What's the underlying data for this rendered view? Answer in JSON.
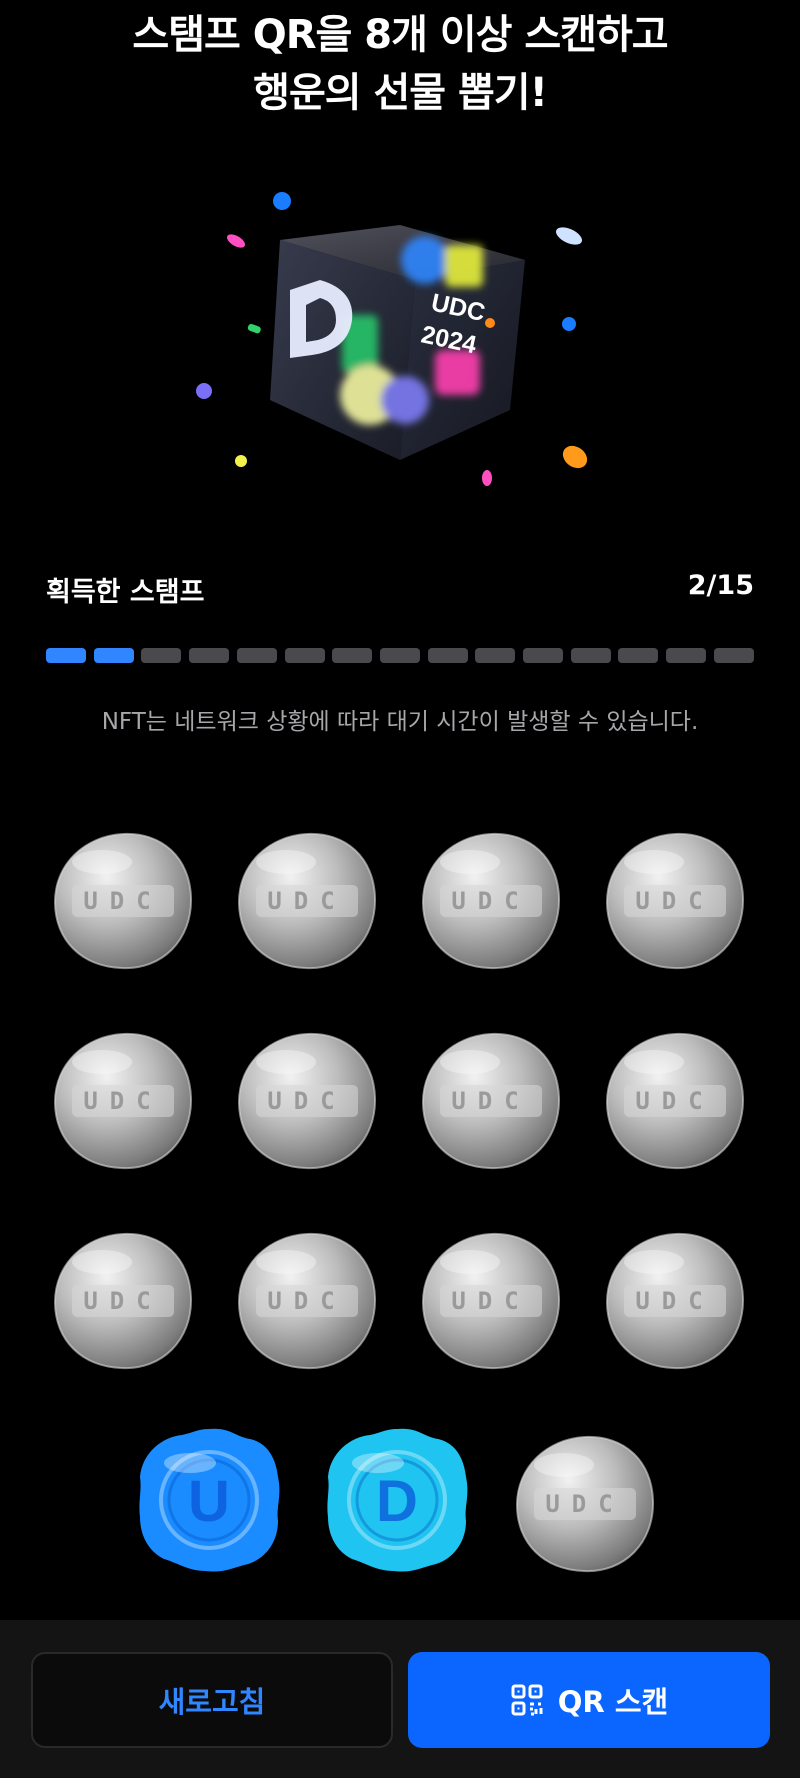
{
  "header": {
    "line1": "스탬프 QR을 8개 이상 스캔하고",
    "line2": "행운의 선물 뽑기!"
  },
  "hero": {
    "logo_letter": "D",
    "cube_line1": "UDC",
    "cube_line2": "2024"
  },
  "progress": {
    "title": "획득한 스탬프",
    "count": "2/15",
    "collected": 2,
    "total": 15
  },
  "notice": "NFT는 네트워크 상황에 따라 대기 시간이 발생할 수 있습니다.",
  "stamps": [
    {
      "state": "locked",
      "label": "UDC"
    },
    {
      "state": "locked",
      "label": "UDC"
    },
    {
      "state": "locked",
      "label": "UDC"
    },
    {
      "state": "locked",
      "label": "UDC"
    },
    {
      "state": "locked",
      "label": "UDC"
    },
    {
      "state": "locked",
      "label": "UDC"
    },
    {
      "state": "locked",
      "label": "UDC"
    },
    {
      "state": "locked",
      "label": "UDC"
    },
    {
      "state": "locked",
      "label": "UDC"
    },
    {
      "state": "locked",
      "label": "UDC"
    },
    {
      "state": "locked",
      "label": "UDC"
    },
    {
      "state": "locked",
      "label": "UDC"
    },
    {
      "state": "collected",
      "label": "U"
    },
    {
      "state": "collected",
      "label": "D"
    },
    {
      "state": "locked",
      "label": "UDC"
    }
  ],
  "footer": {
    "refresh_label": "새로고침",
    "scan_label": "QR 스캔",
    "scan_icon": "qr-code-icon"
  },
  "colors": {
    "accent": "#0a66ff",
    "progress_on": "#2f86ff",
    "progress_off": "#4a4a4e",
    "stamp_blue": "#1a8cff",
    "stamp_cyan": "#20c4f0"
  }
}
